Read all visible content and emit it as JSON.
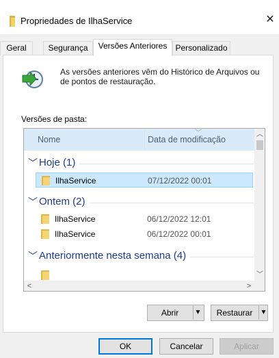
{
  "window": {
    "title": "Propriedades de IlhaService",
    "close_glyph": "✕"
  },
  "tabs": [
    {
      "label": "Geral"
    },
    {
      "label": "Segurança"
    },
    {
      "label": "Versões Anteriores",
      "active": true
    },
    {
      "label": "Personalizado"
    }
  ],
  "info": {
    "icon": "restore-clock-icon",
    "description": "As versões anteriores vêm do Histórico de Arquivos ou de pontos de restauração."
  },
  "list": {
    "label": "Versões de pasta:",
    "columns": {
      "name": "Nome",
      "date": "Data de modificação"
    },
    "groups": [
      {
        "name": "Hoje (1)",
        "items": [
          {
            "name": "IlhaService",
            "date": "07/12/2022 00:01",
            "selected": true
          }
        ]
      },
      {
        "name": "Ontem (2)",
        "items": [
          {
            "name": "IlhaService",
            "date": "06/12/2022 12:01"
          },
          {
            "name": "IlhaService",
            "date": "06/12/2022 00:01"
          }
        ]
      },
      {
        "name": "Anteriormente nesta semana (4)",
        "items": []
      }
    ]
  },
  "actions": {
    "open_label": "Abrir",
    "restore_label": "Restaurar"
  },
  "footer": {
    "ok_label": "OK",
    "cancel_label": "Cancelar",
    "apply_label": "Aplicar"
  },
  "colors": {
    "selection": "#cce8ff",
    "accent": "#0078d7",
    "group_text": "#1e3a8a"
  }
}
